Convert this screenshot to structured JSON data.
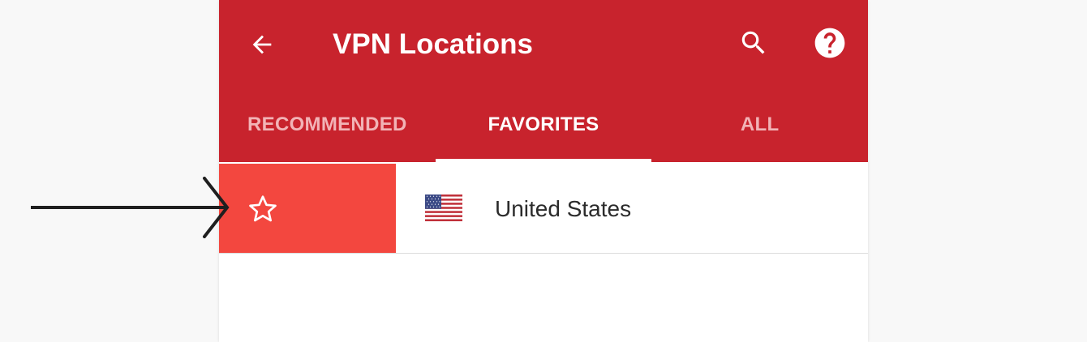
{
  "header": {
    "title": "VPN Locations",
    "back_icon": "arrow-left-icon",
    "search_icon": "search-icon",
    "help_icon": "help-circle-icon"
  },
  "tabs": [
    {
      "label": "RECOMMENDED",
      "active": false
    },
    {
      "label": "FAVORITES",
      "active": true
    },
    {
      "label": "ALL",
      "active": false
    }
  ],
  "locations": [
    {
      "country": "United States",
      "flag": "us-flag-icon",
      "action_icon": "star-outline-icon"
    }
  ],
  "colors": {
    "app_bar": "#c8232d",
    "swipe_action": "#f3473f",
    "inactive_tab": "#f2b3b6",
    "text_primary": "#2b2b2b"
  },
  "annotation": {
    "icon": "pointer-arrow-icon"
  }
}
